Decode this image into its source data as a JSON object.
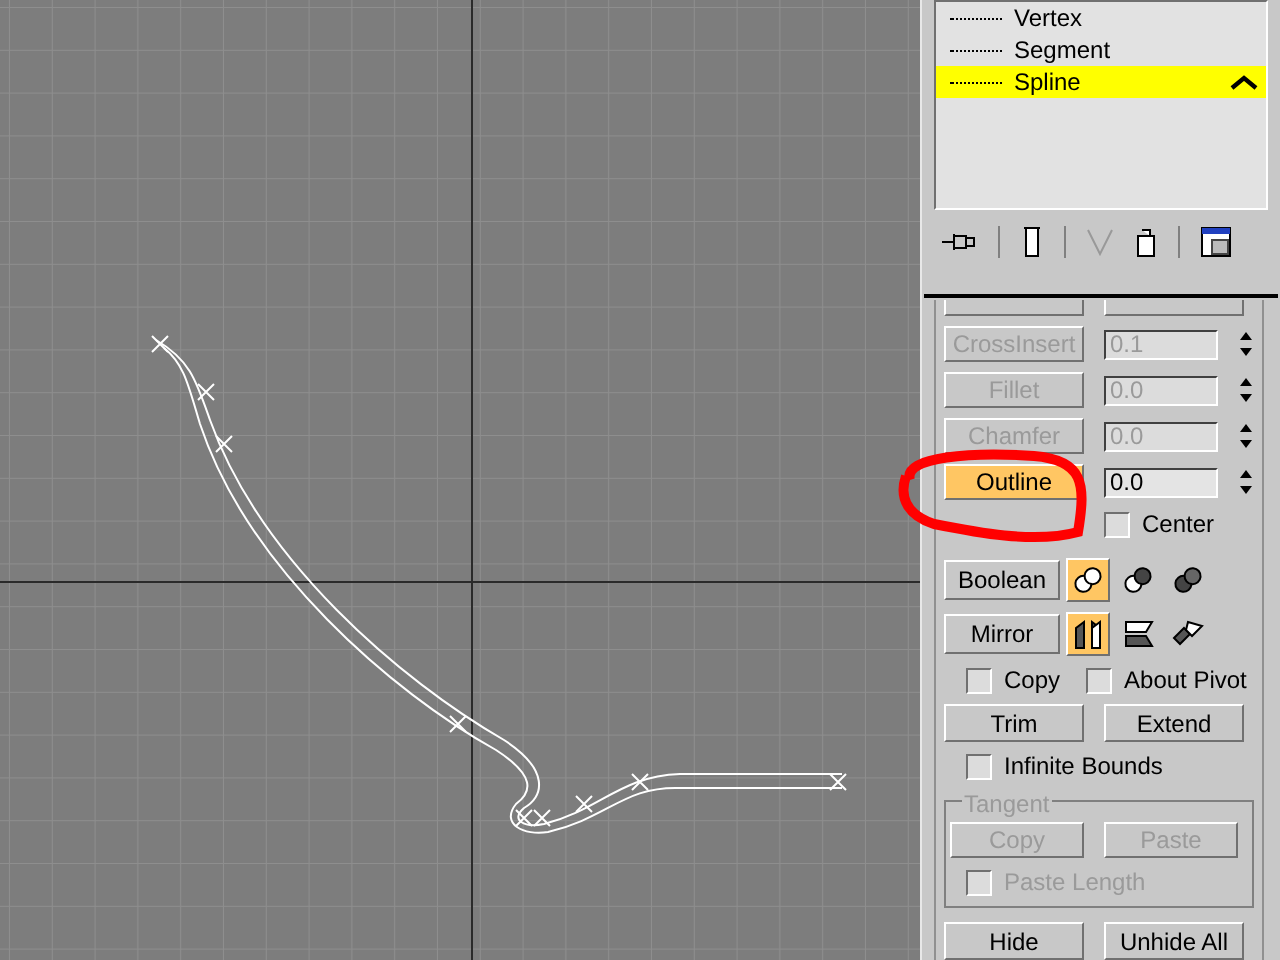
{
  "stack": {
    "items": [
      {
        "label": "Vertex",
        "selected": false
      },
      {
        "label": "Segment",
        "selected": false
      },
      {
        "label": "Spline",
        "selected": true
      }
    ]
  },
  "geometry": {
    "rows": [
      {
        "button": "CrossInsert",
        "disabled": true,
        "active": false,
        "value": "0.1"
      },
      {
        "button": "Fillet",
        "disabled": true,
        "active": false,
        "value": "0.0"
      },
      {
        "button": "Chamfer",
        "disabled": true,
        "active": false,
        "value": "0.0"
      },
      {
        "button": "Outline",
        "disabled": false,
        "active": true,
        "value": "0.0"
      }
    ],
    "center": {
      "label": "Center",
      "checked": false
    },
    "boolean": {
      "label": "Boolean",
      "modes": [
        {
          "selected": true
        },
        {
          "selected": false
        },
        {
          "selected": false
        }
      ]
    },
    "mirror": {
      "label": "Mirror",
      "modes": [
        {
          "selected": true
        },
        {
          "selected": false
        },
        {
          "selected": false
        }
      ]
    },
    "copy": {
      "label": "Copy",
      "checked": false
    },
    "about_pivot": {
      "label": "About Pivot",
      "checked": false
    },
    "trim": "Trim",
    "extend": "Extend",
    "infinite_bounds": {
      "label": "Infinite Bounds",
      "checked": false
    },
    "tangent": {
      "title": "Tangent",
      "disabled": true,
      "copy": "Copy",
      "paste": "Paste",
      "paste_length": {
        "label": "Paste Length",
        "checked": false
      }
    },
    "hide": "Hide",
    "unhide_all": "Unhide All"
  }
}
